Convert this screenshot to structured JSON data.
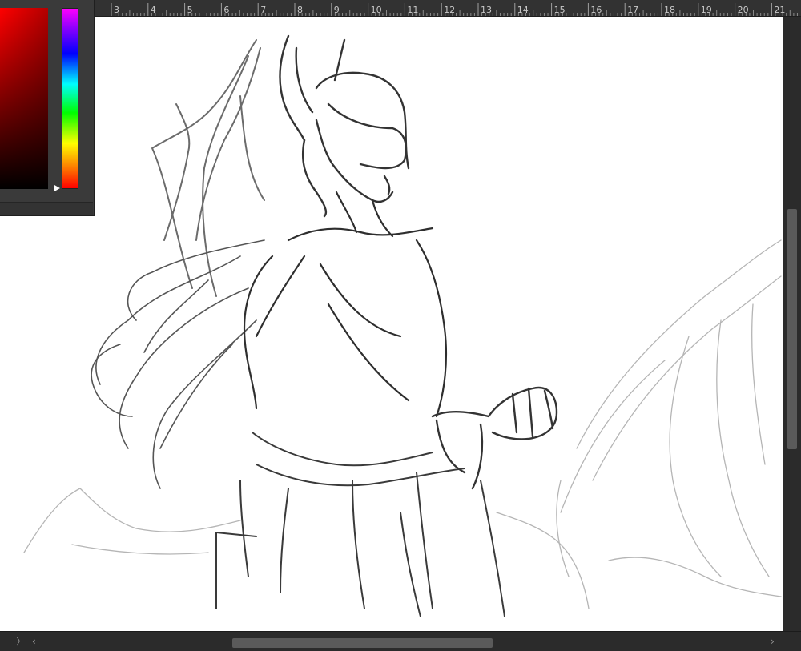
{
  "ruler": {
    "ticks": [
      "3",
      "4",
      "5",
      "6",
      "7",
      "8",
      "9",
      "10",
      "11",
      "12",
      "13",
      "14",
      "15",
      "16",
      "17",
      "18",
      "19",
      "20",
      "21"
    ]
  },
  "color_panel": {
    "base_color": "#ff0000",
    "selected_hue": "red"
  },
  "canvas": {
    "background": "#ffffff",
    "content": "pencil sketch"
  },
  "scrollbars": {
    "left_arrow": "‹",
    "right_arrow": "›",
    "collapse_toggle": "〉"
  }
}
